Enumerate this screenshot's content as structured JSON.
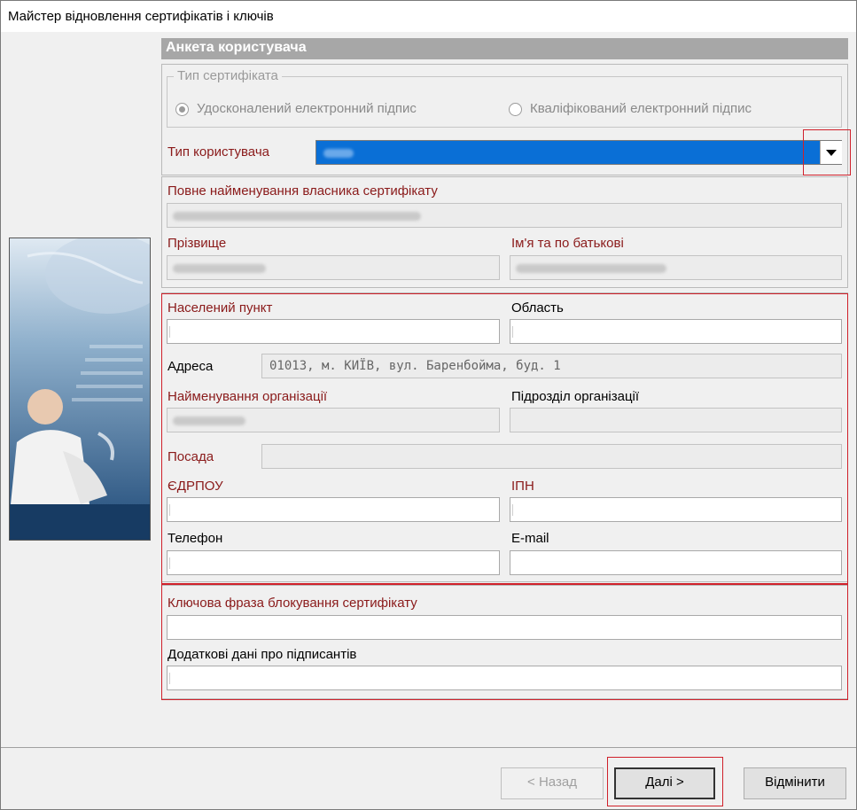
{
  "window": {
    "title": "Майстер відновлення сертифікатів і ключів"
  },
  "section": {
    "title": "Анкета користувача"
  },
  "cert_type": {
    "legend": "Тип сертифіката",
    "options": [
      {
        "label": "Удосконалений електронний підпис",
        "selected": true
      },
      {
        "label": "Кваліфікований електронний підпис",
        "selected": false
      }
    ]
  },
  "user_type": {
    "label": "Тип користувача",
    "value": ""
  },
  "owner": {
    "full_name_label": "Повне найменування власника сертифікату",
    "surname_label": "Прізвище",
    "given_names_label": "Ім'я та по батькові"
  },
  "contact": {
    "city_label": "Населений пункт",
    "region_label": "Область",
    "address_label": "Адреса",
    "address_value": "01013, м. КИЇВ, вул. Баренбойма, буд. 1",
    "org_label": "Найменування організації",
    "dept_label": "Підрозділ організації",
    "position_label": "Посада",
    "edrpou_label": "ЄДРПОУ",
    "ipn_label": "ІПН",
    "phone_label": "Телефон",
    "email_label": "E-mail"
  },
  "extra": {
    "passphrase_label": "Ключова фраза блокування сертифікату",
    "signers_label": "Додаткові дані про підписантів"
  },
  "buttons": {
    "back": "< Назад",
    "next": "Далі >",
    "cancel": "Відмінити"
  },
  "colors": {
    "required_label": "#8a1a1a",
    "highlight": "#d0202a",
    "selection": "#0a6fd6"
  }
}
